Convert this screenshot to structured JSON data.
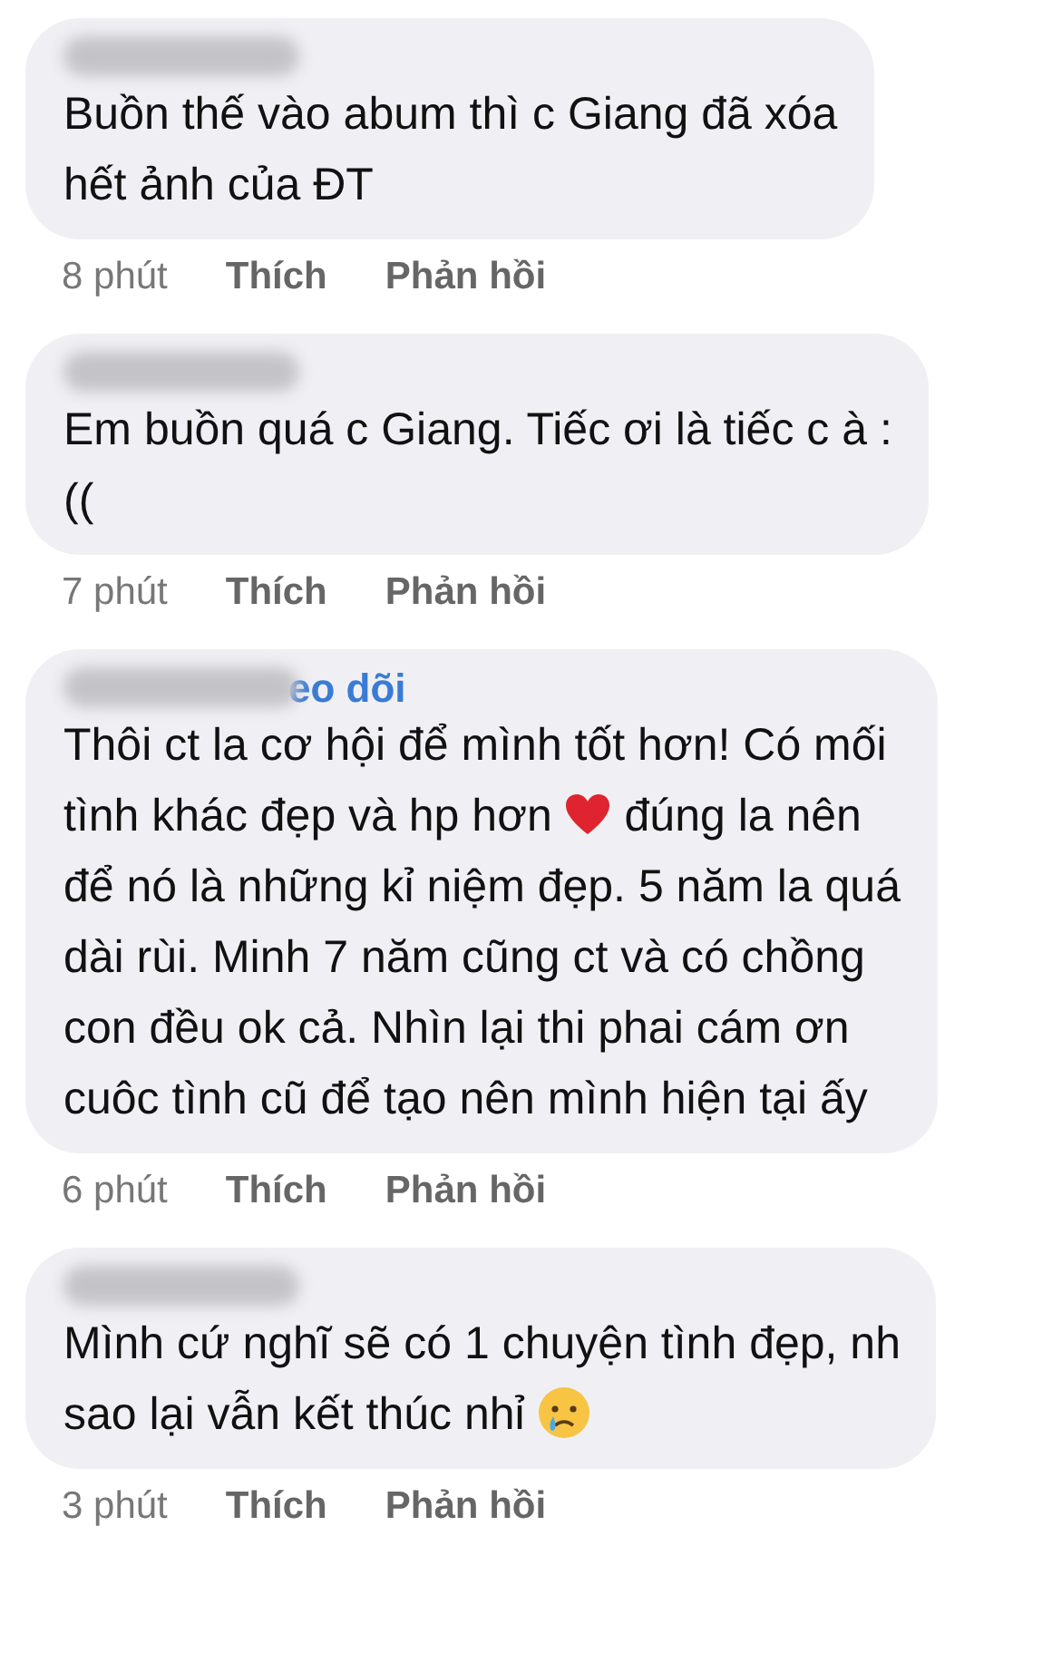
{
  "comments": [
    {
      "lines": [
        [
          {
            "kind": "text",
            "text": "Buồn thế vào abum thì c Giang đã xóa"
          }
        ],
        [
          {
            "kind": "text",
            "text": "hết ảnh của ĐT"
          }
        ]
      ],
      "time": "8 phút",
      "like": "Thích",
      "reply": "Phản hồi"
    },
    {
      "lines": [
        [
          {
            "kind": "text",
            "text": "Em buồn quá c Giang. Tiếc ơi là tiếc c à :"
          }
        ],
        [
          {
            "kind": "text",
            "text": "(("
          }
        ]
      ],
      "time": "7 phút",
      "like": "Thích",
      "reply": "Phản hồi"
    },
    {
      "name_fragment": "eo dõi",
      "lines": [
        [
          {
            "kind": "text",
            "text": "Thôi ct la cơ hội để mình tốt hơn! Có mối"
          }
        ],
        [
          {
            "kind": "text",
            "text": "tình khác đẹp và hp hơn "
          },
          {
            "kind": "heart"
          },
          {
            "kind": "text",
            "text": " đúng la nên"
          }
        ],
        [
          {
            "kind": "text",
            "text": "để nó là những kỉ niệm đẹp. 5 năm la quá"
          }
        ],
        [
          {
            "kind": "text",
            "text": "dài rùi. Minh 7 năm cũng ct và có chồng"
          }
        ],
        [
          {
            "kind": "text",
            "text": "con đều ok cả. Nhìn lại thi phai cám ơn"
          }
        ],
        [
          {
            "kind": "text",
            "text": "cuôc tình cũ để tạo nên mình hiện tại ấy"
          }
        ]
      ],
      "time": "6 phút",
      "like": "Thích",
      "reply": "Phản hồi"
    },
    {
      "lines": [
        [
          {
            "kind": "text",
            "text": "Mình cứ nghĩ sẽ có 1 chuyện tình đẹp, nh"
          }
        ],
        [
          {
            "kind": "text",
            "text": "sao lại vẫn kết thúc nhỉ "
          },
          {
            "kind": "crying"
          }
        ]
      ],
      "time": "3 phút",
      "like": "Thích",
      "reply": "Phản hồi"
    }
  ]
}
